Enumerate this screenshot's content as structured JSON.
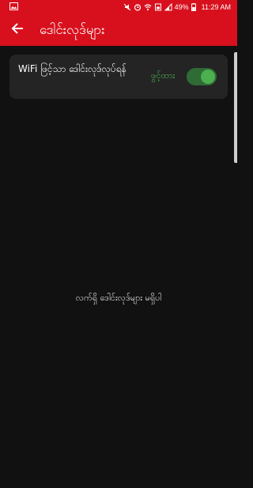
{
  "status_bar": {
    "battery_text": "49%",
    "time": "11:29 AM",
    "icons": [
      "gallery-icon",
      "mute-icon",
      "alarm-icon",
      "wifi-icon",
      "sim-icon",
      "signal-icon",
      "battery-icon"
    ]
  },
  "app_bar": {
    "title": "ဒေါင်းလုဒ်များ",
    "back_icon": "arrow-left-icon"
  },
  "setting": {
    "label": "WiFi ဖြင့်သာ ဒေါင်းလုဒ်လုပ်ရန်",
    "state_label": "ဖွင့်ထား",
    "enabled": true
  },
  "empty_message": "လက်ရှိ ဒေါင်းလုဒ်များ မရှိပါ",
  "colors": {
    "brand_red": "#d8101d",
    "background": "#111111",
    "card": "#242424",
    "toggle_on": "#4caf50"
  }
}
